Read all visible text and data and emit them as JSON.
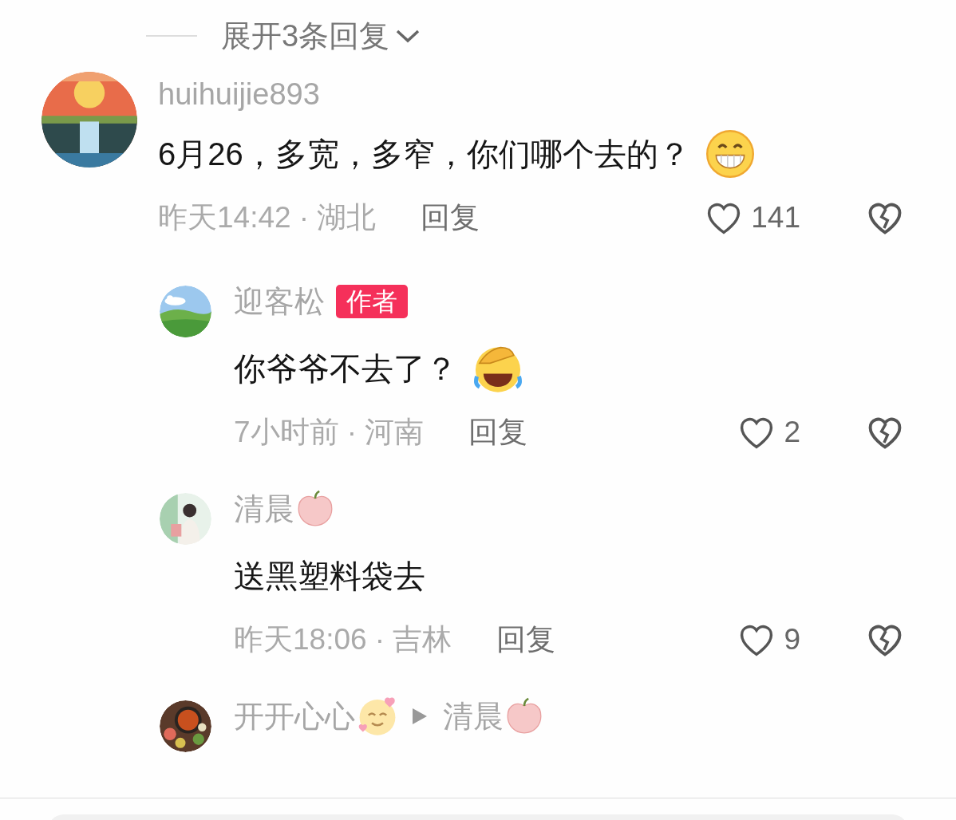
{
  "expand": {
    "label": "展开3条回复"
  },
  "comment": {
    "user": "huihuijie893",
    "text": "6月26，多宽，多窄，你们哪个去的？",
    "meta": "昨天14:42 · 湖北",
    "reply_label": "回复",
    "likes": "141"
  },
  "replies": [
    {
      "user": "迎客松",
      "badge": "作者",
      "text": "你爷爷不去了？",
      "meta": "7小时前 · 河南",
      "reply_label": "回复",
      "likes": "2"
    },
    {
      "user": "清晨",
      "text": "送黑塑料袋去",
      "meta": "昨天18:06 · 吉林",
      "reply_label": "回复",
      "likes": "9"
    },
    {
      "user": "开开心心",
      "reply_to": "清晨"
    }
  ]
}
